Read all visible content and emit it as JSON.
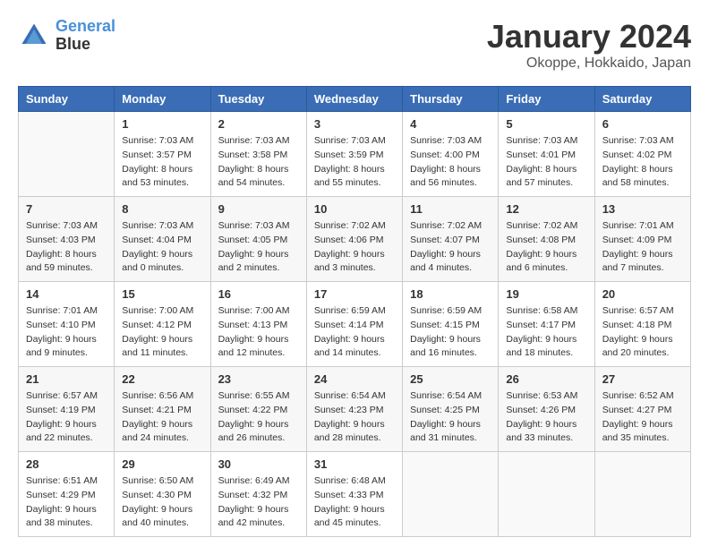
{
  "logo": {
    "line1": "General",
    "line2": "Blue"
  },
  "title": "January 2024",
  "location": "Okoppe, Hokkaido, Japan",
  "days_of_week": [
    "Sunday",
    "Monday",
    "Tuesday",
    "Wednesday",
    "Thursday",
    "Friday",
    "Saturday"
  ],
  "weeks": [
    [
      {
        "day": "",
        "sunrise": "",
        "sunset": "",
        "daylight": ""
      },
      {
        "day": "1",
        "sunrise": "Sunrise: 7:03 AM",
        "sunset": "Sunset: 3:57 PM",
        "daylight": "Daylight: 8 hours and 53 minutes."
      },
      {
        "day": "2",
        "sunrise": "Sunrise: 7:03 AM",
        "sunset": "Sunset: 3:58 PM",
        "daylight": "Daylight: 8 hours and 54 minutes."
      },
      {
        "day": "3",
        "sunrise": "Sunrise: 7:03 AM",
        "sunset": "Sunset: 3:59 PM",
        "daylight": "Daylight: 8 hours and 55 minutes."
      },
      {
        "day": "4",
        "sunrise": "Sunrise: 7:03 AM",
        "sunset": "Sunset: 4:00 PM",
        "daylight": "Daylight: 8 hours and 56 minutes."
      },
      {
        "day": "5",
        "sunrise": "Sunrise: 7:03 AM",
        "sunset": "Sunset: 4:01 PM",
        "daylight": "Daylight: 8 hours and 57 minutes."
      },
      {
        "day": "6",
        "sunrise": "Sunrise: 7:03 AM",
        "sunset": "Sunset: 4:02 PM",
        "daylight": "Daylight: 8 hours and 58 minutes."
      }
    ],
    [
      {
        "day": "7",
        "sunrise": "Sunrise: 7:03 AM",
        "sunset": "Sunset: 4:03 PM",
        "daylight": "Daylight: 8 hours and 59 minutes."
      },
      {
        "day": "8",
        "sunrise": "Sunrise: 7:03 AM",
        "sunset": "Sunset: 4:04 PM",
        "daylight": "Daylight: 9 hours and 0 minutes."
      },
      {
        "day": "9",
        "sunrise": "Sunrise: 7:03 AM",
        "sunset": "Sunset: 4:05 PM",
        "daylight": "Daylight: 9 hours and 2 minutes."
      },
      {
        "day": "10",
        "sunrise": "Sunrise: 7:02 AM",
        "sunset": "Sunset: 4:06 PM",
        "daylight": "Daylight: 9 hours and 3 minutes."
      },
      {
        "day": "11",
        "sunrise": "Sunrise: 7:02 AM",
        "sunset": "Sunset: 4:07 PM",
        "daylight": "Daylight: 9 hours and 4 minutes."
      },
      {
        "day": "12",
        "sunrise": "Sunrise: 7:02 AM",
        "sunset": "Sunset: 4:08 PM",
        "daylight": "Daylight: 9 hours and 6 minutes."
      },
      {
        "day": "13",
        "sunrise": "Sunrise: 7:01 AM",
        "sunset": "Sunset: 4:09 PM",
        "daylight": "Daylight: 9 hours and 7 minutes."
      }
    ],
    [
      {
        "day": "14",
        "sunrise": "Sunrise: 7:01 AM",
        "sunset": "Sunset: 4:10 PM",
        "daylight": "Daylight: 9 hours and 9 minutes."
      },
      {
        "day": "15",
        "sunrise": "Sunrise: 7:00 AM",
        "sunset": "Sunset: 4:12 PM",
        "daylight": "Daylight: 9 hours and 11 minutes."
      },
      {
        "day": "16",
        "sunrise": "Sunrise: 7:00 AM",
        "sunset": "Sunset: 4:13 PM",
        "daylight": "Daylight: 9 hours and 12 minutes."
      },
      {
        "day": "17",
        "sunrise": "Sunrise: 6:59 AM",
        "sunset": "Sunset: 4:14 PM",
        "daylight": "Daylight: 9 hours and 14 minutes."
      },
      {
        "day": "18",
        "sunrise": "Sunrise: 6:59 AM",
        "sunset": "Sunset: 4:15 PM",
        "daylight": "Daylight: 9 hours and 16 minutes."
      },
      {
        "day": "19",
        "sunrise": "Sunrise: 6:58 AM",
        "sunset": "Sunset: 4:17 PM",
        "daylight": "Daylight: 9 hours and 18 minutes."
      },
      {
        "day": "20",
        "sunrise": "Sunrise: 6:57 AM",
        "sunset": "Sunset: 4:18 PM",
        "daylight": "Daylight: 9 hours and 20 minutes."
      }
    ],
    [
      {
        "day": "21",
        "sunrise": "Sunrise: 6:57 AM",
        "sunset": "Sunset: 4:19 PM",
        "daylight": "Daylight: 9 hours and 22 minutes."
      },
      {
        "day": "22",
        "sunrise": "Sunrise: 6:56 AM",
        "sunset": "Sunset: 4:21 PM",
        "daylight": "Daylight: 9 hours and 24 minutes."
      },
      {
        "day": "23",
        "sunrise": "Sunrise: 6:55 AM",
        "sunset": "Sunset: 4:22 PM",
        "daylight": "Daylight: 9 hours and 26 minutes."
      },
      {
        "day": "24",
        "sunrise": "Sunrise: 6:54 AM",
        "sunset": "Sunset: 4:23 PM",
        "daylight": "Daylight: 9 hours and 28 minutes."
      },
      {
        "day": "25",
        "sunrise": "Sunrise: 6:54 AM",
        "sunset": "Sunset: 4:25 PM",
        "daylight": "Daylight: 9 hours and 31 minutes."
      },
      {
        "day": "26",
        "sunrise": "Sunrise: 6:53 AM",
        "sunset": "Sunset: 4:26 PM",
        "daylight": "Daylight: 9 hours and 33 minutes."
      },
      {
        "day": "27",
        "sunrise": "Sunrise: 6:52 AM",
        "sunset": "Sunset: 4:27 PM",
        "daylight": "Daylight: 9 hours and 35 minutes."
      }
    ],
    [
      {
        "day": "28",
        "sunrise": "Sunrise: 6:51 AM",
        "sunset": "Sunset: 4:29 PM",
        "daylight": "Daylight: 9 hours and 38 minutes."
      },
      {
        "day": "29",
        "sunrise": "Sunrise: 6:50 AM",
        "sunset": "Sunset: 4:30 PM",
        "daylight": "Daylight: 9 hours and 40 minutes."
      },
      {
        "day": "30",
        "sunrise": "Sunrise: 6:49 AM",
        "sunset": "Sunset: 4:32 PM",
        "daylight": "Daylight: 9 hours and 42 minutes."
      },
      {
        "day": "31",
        "sunrise": "Sunrise: 6:48 AM",
        "sunset": "Sunset: 4:33 PM",
        "daylight": "Daylight: 9 hours and 45 minutes."
      },
      {
        "day": "",
        "sunrise": "",
        "sunset": "",
        "daylight": ""
      },
      {
        "day": "",
        "sunrise": "",
        "sunset": "",
        "daylight": ""
      },
      {
        "day": "",
        "sunrise": "",
        "sunset": "",
        "daylight": ""
      }
    ]
  ]
}
